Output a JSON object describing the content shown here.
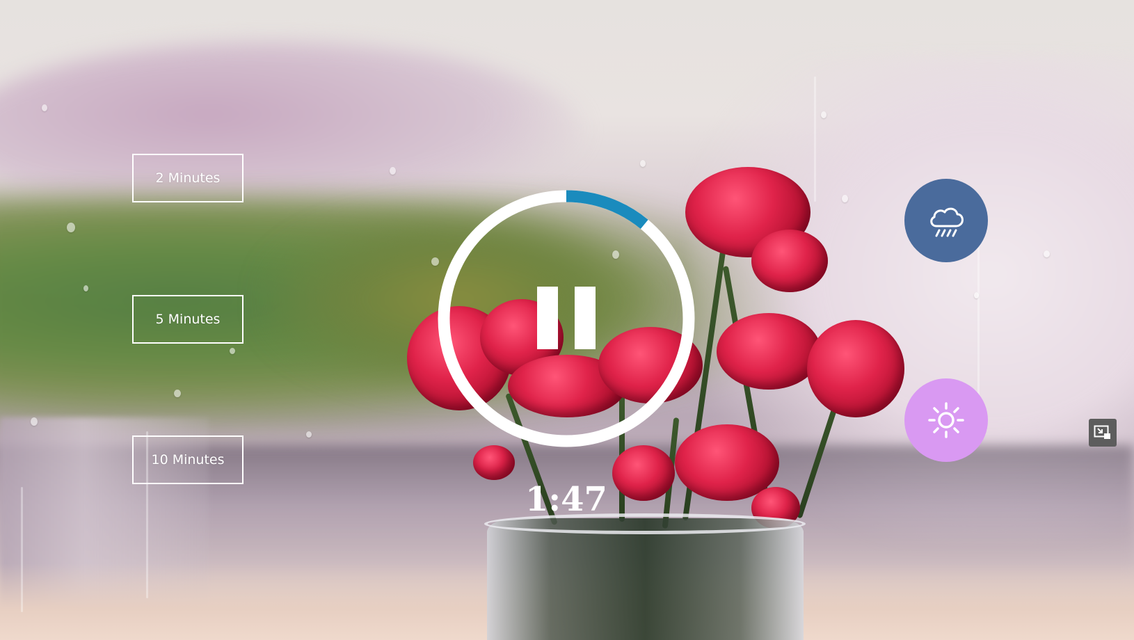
{
  "durations": [
    {
      "label": "2 Minutes"
    },
    {
      "label": "5 Minutes"
    },
    {
      "label": "10 Minutes"
    }
  ],
  "timer": {
    "remaining": "1:47",
    "progress_fraction": 0.11,
    "state_icon": "pause-icon"
  },
  "modes": [
    {
      "name": "rain",
      "icon": "cloud-rain-icon",
      "color": "#4a6b9c"
    },
    {
      "name": "sun",
      "icon": "sun-icon",
      "color": "#d999f2"
    }
  ],
  "pip_icon": "picture-in-picture-icon",
  "colors": {
    "ring": "#ffffff",
    "progress": "#1a8bbd",
    "text": "#ffffff"
  }
}
